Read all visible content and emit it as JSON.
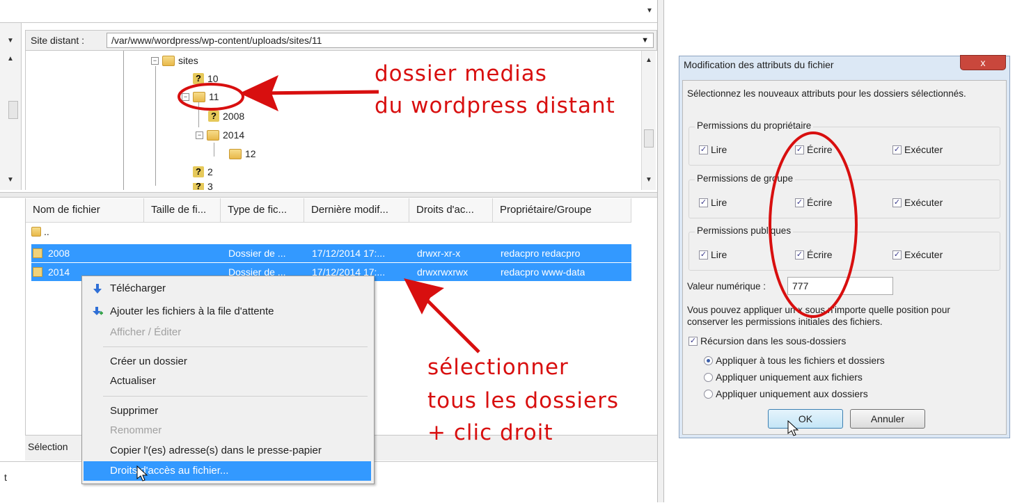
{
  "remote": {
    "label": "Site distant :",
    "path": "/var/www/wordpress/wp-content/uploads/sites/11"
  },
  "tree": {
    "nodes": [
      "sites",
      "10",
      "11",
      "2008",
      "2014",
      "12",
      "2",
      "3"
    ]
  },
  "list": {
    "columns": [
      "Nom de fichier",
      "Taille de fi...",
      "Type de fic...",
      "Dernière modif...",
      "Droits d'ac...",
      "Propriétaire/Groupe"
    ],
    "parent": "..",
    "rows": [
      {
        "name": "2008",
        "type": "Dossier de ...",
        "modified": "17/12/2014 17:...",
        "perms": "drwxr-xr-x",
        "owner": "redacpro redacpro"
      },
      {
        "name": "2014",
        "type": "Dossier de ...",
        "modified": "17/12/2014 17:...",
        "perms": "drwxrwxrwx",
        "owner": "redacpro www-data"
      }
    ]
  },
  "status": {
    "label": "Sélection"
  },
  "bottom": {
    "text": "t"
  },
  "context_menu": {
    "items": [
      {
        "label": "Télécharger",
        "disabled": false,
        "icon": "download-icon"
      },
      {
        "label": "Ajouter les fichiers à la file d'attente",
        "disabled": false,
        "icon": "queue-add-icon"
      },
      {
        "label": "Afficher / Éditer",
        "disabled": true
      },
      {
        "label": "Créer un dossier",
        "disabled": false
      },
      {
        "label": "Actualiser",
        "disabled": false
      },
      {
        "label": "Supprimer",
        "disabled": false
      },
      {
        "label": "Renommer",
        "disabled": true
      },
      {
        "label": "Copier l'(es) adresse(s) dans le presse-papier",
        "disabled": false
      },
      {
        "label": "Droits d'accès au fichier...",
        "disabled": false,
        "highlighted": true
      }
    ]
  },
  "annotations": {
    "top_line1": "dossier medias",
    "top_line2": "du wordpress distant",
    "bottom_line1": "sélectionner",
    "bottom_line2": "tous les dossiers",
    "bottom_line3": "+ clic droit",
    "color": "#d80f0f"
  },
  "dialog": {
    "title": "Modification des attributs du fichier",
    "close": "x",
    "intro": "Sélectionnez les nouveaux attributs pour les dossiers sélectionnés.",
    "groups": [
      {
        "title": "Permissions du propriétaire",
        "read": "Lire",
        "write": "Écrire",
        "exec": "Exécuter"
      },
      {
        "title": "Permissions de groupe",
        "read": "Lire",
        "write": "Écrire",
        "exec": "Exécuter"
      },
      {
        "title": "Permissions publiques",
        "read": "Lire",
        "write": "Écrire",
        "exec": "Exécuter"
      }
    ],
    "numeric_label": "Valeur numérique :",
    "numeric_value": "777",
    "hint_line1": "Vous pouvez appliquer un x sous n'importe quelle position pour",
    "hint_line2": "conserver les permissions initiales des fichiers.",
    "recursion": "Récursion dans les sous-dossiers",
    "radios": [
      "Appliquer à tous les fichiers et dossiers",
      "Appliquer uniquement aux fichiers",
      "Appliquer uniquement aux dossiers"
    ],
    "ok": "OK",
    "cancel": "Annuler"
  },
  "check_mark": "✓",
  "colors": {
    "selection": "#3399ff",
    "annotation": "#d80f0f",
    "dialog_frame": "#dce8f5"
  }
}
